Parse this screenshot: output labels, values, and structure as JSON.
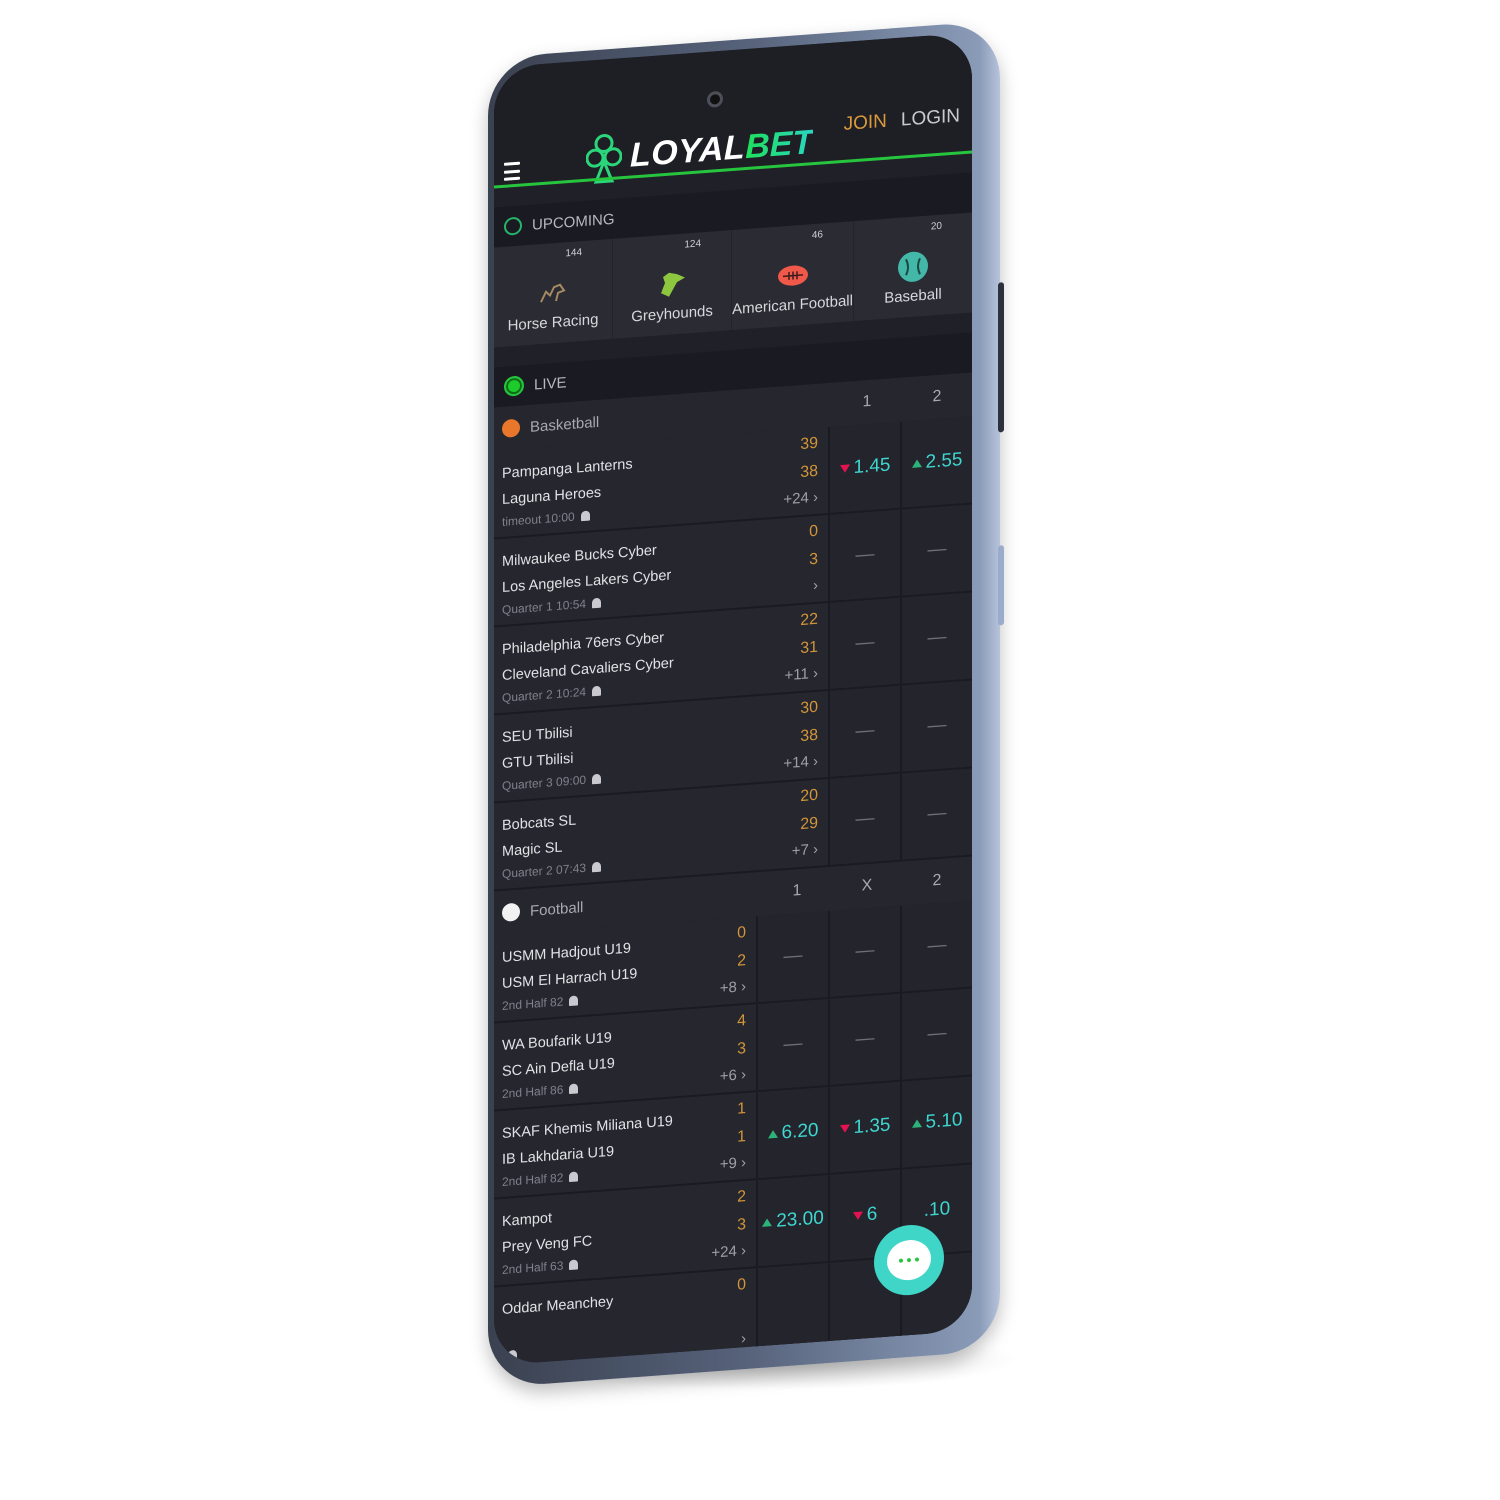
{
  "header": {
    "brand_part1": "LOYAL",
    "brand_part2": "BET",
    "join_label": "JOIN",
    "login_label": "LOGIN"
  },
  "upcoming": {
    "title": "UPCOMING",
    "sports": [
      {
        "name": "Horse Racing",
        "count": "144",
        "icon": "horse-icon"
      },
      {
        "name": "Greyhounds",
        "count": "124",
        "icon": "greyhound-icon"
      },
      {
        "name": "American Football",
        "count": "46",
        "icon": "american-football-icon"
      },
      {
        "name": "Baseball",
        "count": "20",
        "icon": "baseball-icon"
      }
    ]
  },
  "live": {
    "title": "LIVE",
    "basketball": {
      "league": "Basketball",
      "columns": [
        "1",
        "2"
      ],
      "matches": [
        {
          "home": "Pampanga Lanterns",
          "away": "Laguna Heroes",
          "status": "timeout 10:00",
          "score_home": "39",
          "score_away": "38",
          "more": "+24",
          "odds": [
            {
              "value": "1.45",
              "trend": "down"
            },
            {
              "value": "2.55",
              "trend": "up"
            }
          ]
        },
        {
          "home": "Milwaukee Bucks Cyber",
          "away": "Los Angeles Lakers Cyber",
          "status": "Quarter 1 10:54",
          "score_home": "0",
          "score_away": "3",
          "more": "",
          "odds": [
            {
              "value": "—",
              "trend": ""
            },
            {
              "value": "—",
              "trend": ""
            }
          ]
        },
        {
          "home": "Philadelphia 76ers Cyber",
          "away": "Cleveland Cavaliers Cyber",
          "status": "Quarter 2 10:24",
          "score_home": "22",
          "score_away": "31",
          "more": "+11",
          "odds": [
            {
              "value": "—",
              "trend": ""
            },
            {
              "value": "—",
              "trend": ""
            }
          ]
        },
        {
          "home": "SEU Tbilisi",
          "away": "GTU Tbilisi",
          "status": "Quarter 3 09:00",
          "score_home": "30",
          "score_away": "38",
          "more": "+14",
          "odds": [
            {
              "value": "—",
              "trend": ""
            },
            {
              "value": "—",
              "trend": ""
            }
          ]
        },
        {
          "home": "Bobcats SL",
          "away": "Magic SL",
          "status": "Quarter 2 07:43",
          "score_home": "20",
          "score_away": "29",
          "more": "+7",
          "odds": [
            {
              "value": "—",
              "trend": ""
            },
            {
              "value": "—",
              "trend": ""
            }
          ]
        }
      ]
    },
    "football": {
      "league": "Football",
      "columns": [
        "1",
        "X",
        "2"
      ],
      "matches": [
        {
          "home": "USMM Hadjout U19",
          "away": "USM El Harrach U19",
          "status": "2nd Half 82",
          "score_home": "0",
          "score_away": "2",
          "more": "+8",
          "odds": [
            {
              "value": "—",
              "trend": ""
            },
            {
              "value": "—",
              "trend": ""
            },
            {
              "value": "—",
              "trend": ""
            }
          ]
        },
        {
          "home": "WA Boufarik U19",
          "away": "SC Ain Defla U19",
          "status": "2nd Half 86",
          "score_home": "4",
          "score_away": "3",
          "more": "+6",
          "odds": [
            {
              "value": "—",
              "trend": ""
            },
            {
              "value": "—",
              "trend": ""
            },
            {
              "value": "—",
              "trend": ""
            }
          ]
        },
        {
          "home": "SKAF Khemis Miliana U19",
          "away": "IB Lakhdaria U19",
          "status": "2nd Half 82",
          "score_home": "1",
          "score_away": "1",
          "more": "+9",
          "odds": [
            {
              "value": "6.20",
              "trend": "up"
            },
            {
              "value": "1.35",
              "trend": "down"
            },
            {
              "value": "5.10",
              "trend": "up"
            }
          ]
        },
        {
          "home": "Kampot",
          "away": "Prey Veng FC",
          "status": "2nd Half 63",
          "score_home": "2",
          "score_away": "3",
          "more": "+24",
          "odds": [
            {
              "value": "23.00",
              "trend": "up"
            },
            {
              "value": "6",
              "trend": "down"
            },
            {
              "value": ".10",
              "trend": ""
            }
          ]
        },
        {
          "home": "Oddar Meanchey",
          "away": "",
          "status": "",
          "score_home": "0",
          "score_away": "",
          "more": "",
          "odds": [
            {
              "value": "",
              "trend": ""
            },
            {
              "value": "",
              "trend": ""
            },
            {
              "value": "",
              "trend": ""
            }
          ]
        }
      ]
    }
  },
  "colors": {
    "accent_green": "#27c43e",
    "odds_teal": "#3fd6d0",
    "score_orange": "#d2953a",
    "join_orange": "#d99a3c",
    "trend_up": "#2db37a",
    "trend_down": "#e3134f"
  }
}
